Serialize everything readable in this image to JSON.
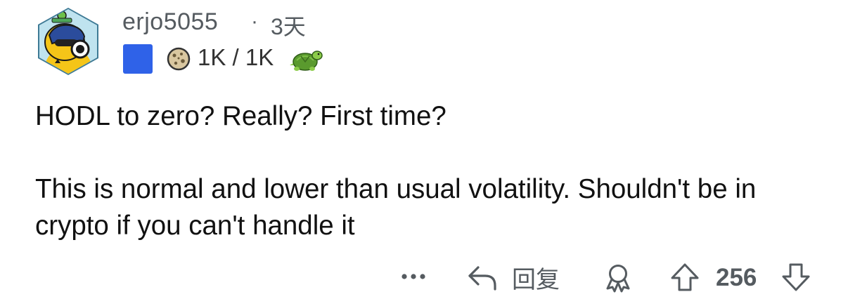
{
  "comment": {
    "author": "erjo5055",
    "separator": "·",
    "time_ago": "3天",
    "flair": {
      "color": "#2f62e8",
      "karma": "1K / 1K"
    },
    "paragraphs": [
      "HODL to zero? Really? First time?",
      "This is normal and lower than usual volatility. Shouldn't be in crypto if you can't handle it"
    ]
  },
  "actions": {
    "more_icon": "more-horizontal-icon",
    "reply_label": "回复",
    "award_icon": "award-icon",
    "upvote_icon": "arrow-up-icon",
    "score": "256",
    "downvote_icon": "arrow-down-icon"
  },
  "colors": {
    "secondary_text": "#555b60",
    "body_text": "#111111",
    "avatar_frame": "#3e7a95",
    "avatar_yellow": "#f5c518"
  }
}
